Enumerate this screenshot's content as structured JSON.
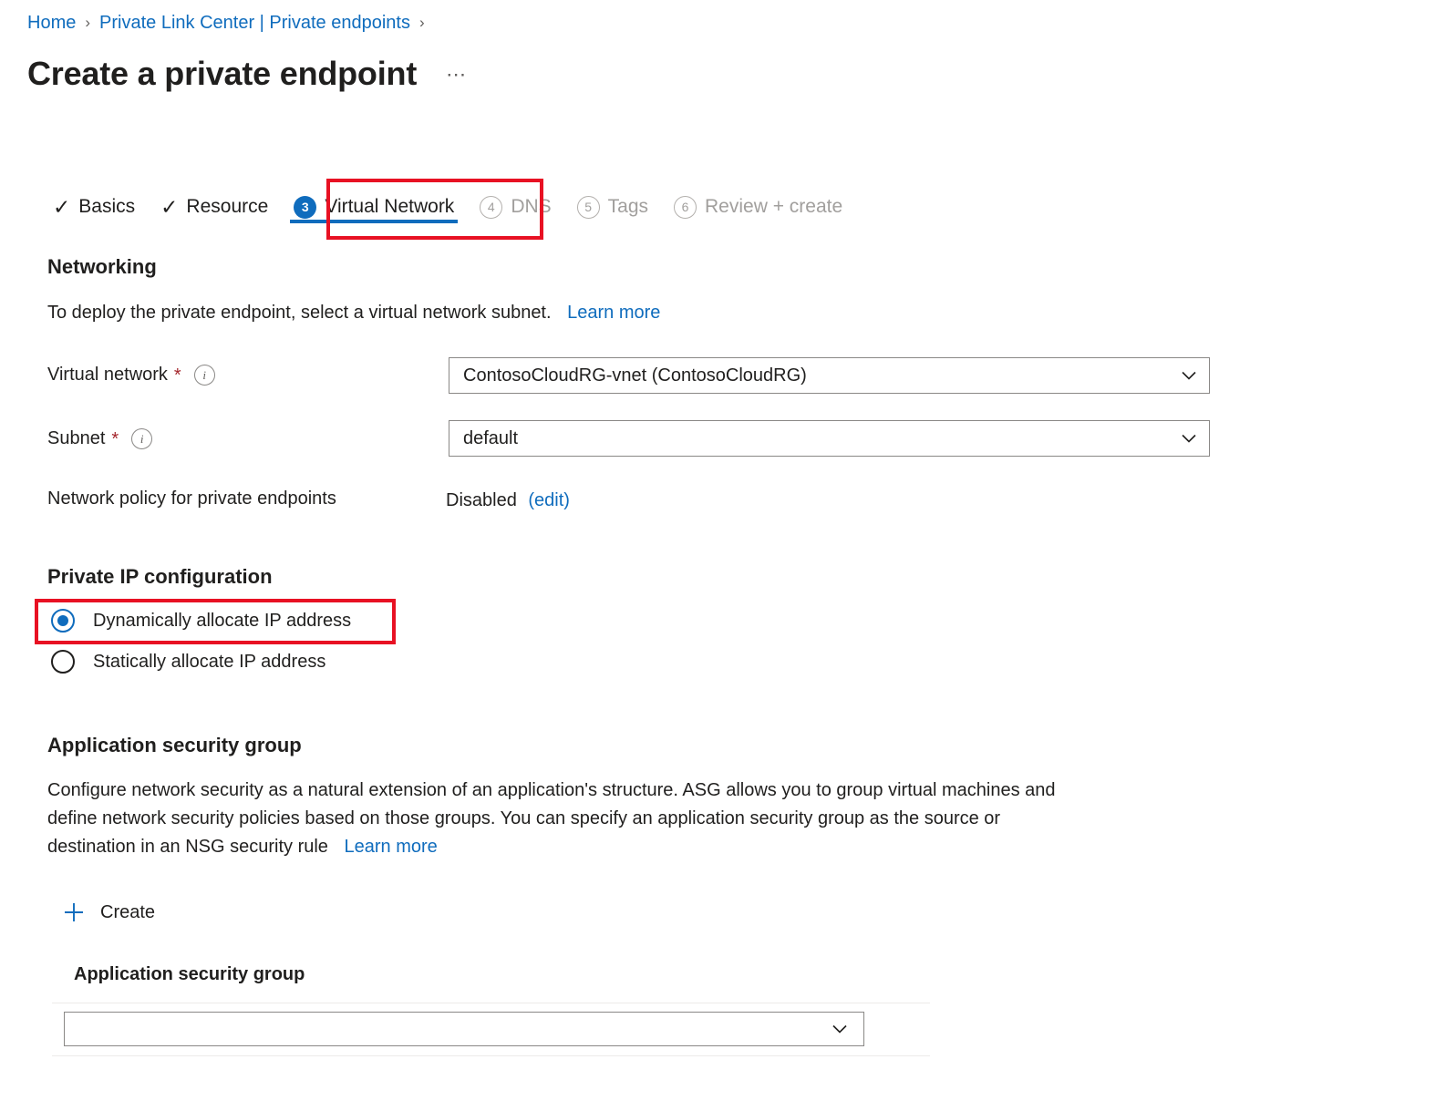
{
  "breadcrumb": {
    "items": [
      {
        "label": "Home"
      },
      {
        "label": "Private Link Center | Private endpoints"
      }
    ],
    "separator": "›"
  },
  "header": {
    "title": "Create a private endpoint",
    "more_menu": "⋯"
  },
  "wizard": {
    "tabs": [
      {
        "label": "Basics",
        "state": "done",
        "marker": "✓"
      },
      {
        "label": "Resource",
        "state": "done",
        "marker": "✓"
      },
      {
        "label": "Virtual Network",
        "state": "current",
        "marker": "3"
      },
      {
        "label": "DNS",
        "state": "upcoming",
        "marker": "4"
      },
      {
        "label": "Tags",
        "state": "upcoming",
        "marker": "5"
      },
      {
        "label": "Review + create",
        "state": "upcoming",
        "marker": "6"
      }
    ]
  },
  "networking": {
    "heading": "Networking",
    "description": "To deploy the private endpoint, select a virtual network subnet.",
    "learn_more": "Learn more",
    "virtual_network": {
      "label": "Virtual network",
      "required_marker": "*",
      "info": "i",
      "value": "ContosoCloudRG-vnet (ContosoCloudRG)"
    },
    "subnet": {
      "label": "Subnet",
      "required_marker": "*",
      "info": "i",
      "value": "default"
    },
    "network_policy": {
      "label": "Network policy for private endpoints",
      "value": "Disabled",
      "edit_link": "(edit)"
    }
  },
  "private_ip": {
    "heading": "Private IP configuration",
    "options": [
      {
        "label": "Dynamically allocate IP address",
        "selected": true
      },
      {
        "label": "Statically allocate IP address",
        "selected": false
      }
    ]
  },
  "asg": {
    "heading": "Application security group",
    "description_line1": "Configure network security as a natural extension of an application's structure. ASG allows you to group virtual machines and",
    "description_line2": "define network security policies based on those groups. You can specify an application security group as the source or",
    "description_line3": "destination in an NSG security rule",
    "learn_more": "Learn more",
    "create_label": "Create",
    "column_header": "Application security group",
    "selected_value": ""
  },
  "colors": {
    "accent_blue": "#0f6cbd",
    "highlight_red": "#e81123",
    "required_red": "#a4262c",
    "disabled_grey": "#a19f9d",
    "text": "#201f1e"
  }
}
